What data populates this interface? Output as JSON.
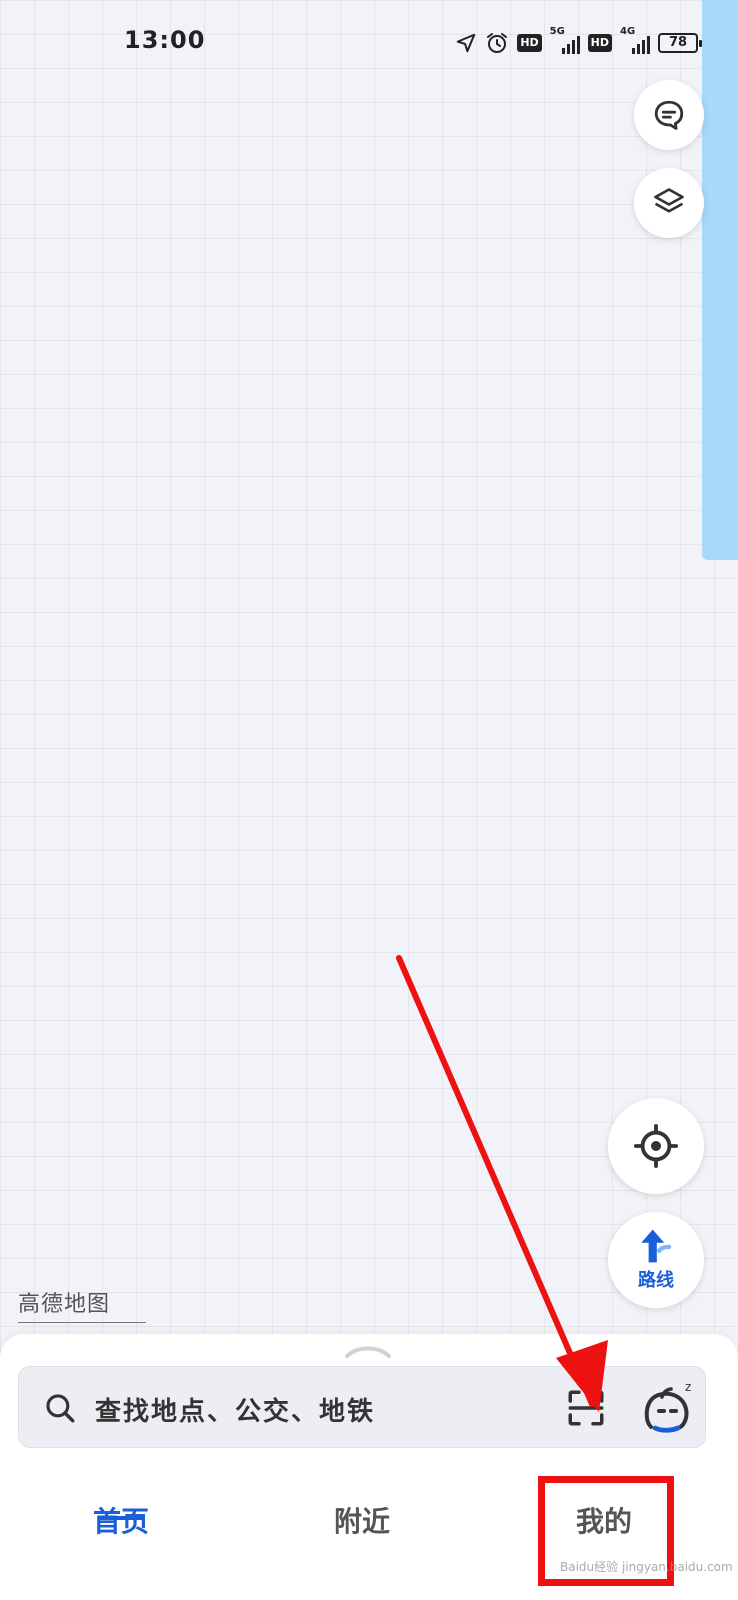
{
  "status_bar": {
    "time": "13:00",
    "hd_badge": "HD",
    "network_1": "5G",
    "network_2": "4G",
    "battery": "78"
  },
  "map": {
    "logo": "高德地图",
    "water_color": "#a6d9fb"
  },
  "controls": {
    "route_label": "路线"
  },
  "search": {
    "placeholder": "查找地点、公交、地铁"
  },
  "tabs": [
    {
      "label": "首页",
      "active": true
    },
    {
      "label": "附近",
      "active": false
    },
    {
      "label": "我的",
      "active": false
    }
  ],
  "overlay": {
    "watermark": "Baidu经验 jingyan.baidu.com"
  },
  "colors": {
    "accent": "#1a5fd8",
    "annotation": "#ee1111"
  }
}
